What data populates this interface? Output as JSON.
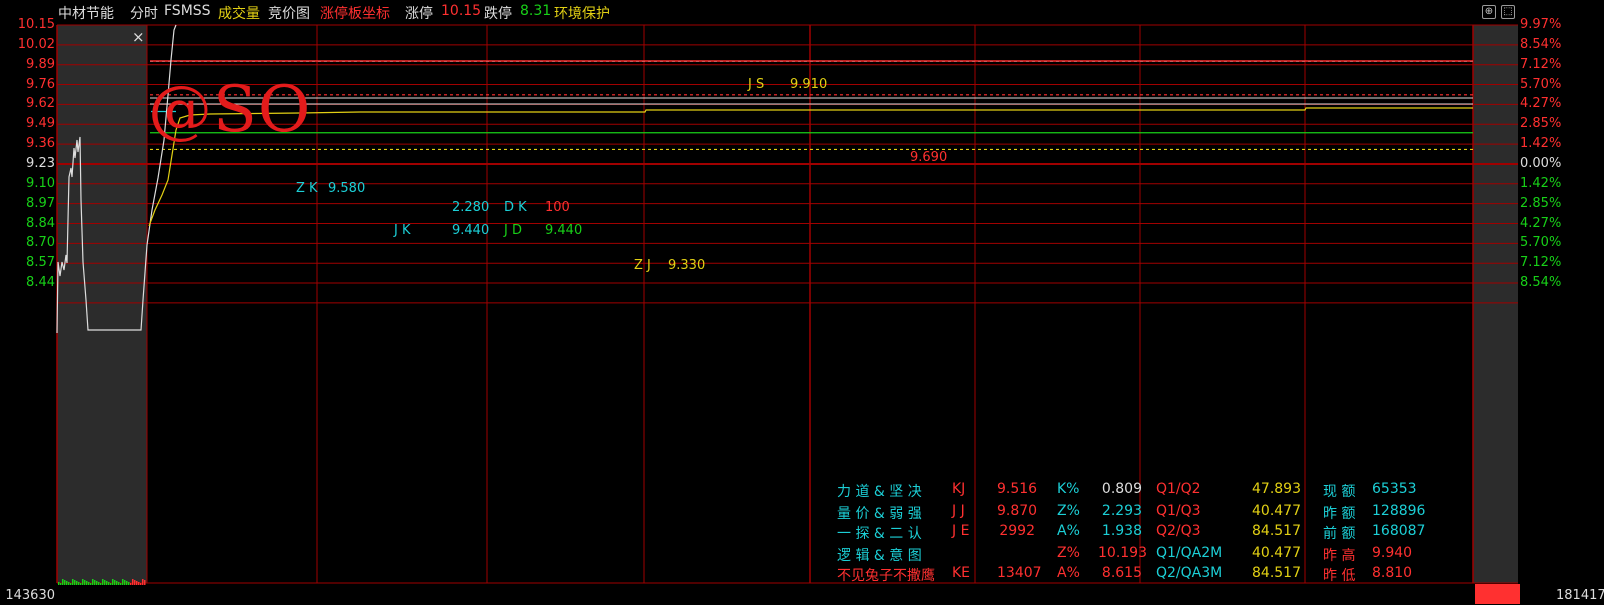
{
  "header": {
    "stock_name": "中材节能",
    "mode": "分时",
    "indicator": "FSMSS",
    "volume": "成交量",
    "auction": "竞价图",
    "limit_axis": "涨停板坐标",
    "limit_up_label": "涨停",
    "limit_up_value": "10.15",
    "limit_down_label": "跌停",
    "limit_down_value": "8.31",
    "env": "环境保护"
  },
  "colors": {
    "up": "#ff3030",
    "down": "#18d018",
    "grid": "#a00000",
    "cyan": "#1ccfd6",
    "yellow": "#e2d014",
    "white": "#dddddd"
  },
  "close_label": "×",
  "window_icons": [
    "restore-icon",
    "expand-icon"
  ],
  "watermark": "@SO",
  "y_axis": {
    "prices": [
      "10.15",
      "10.02",
      "9.89",
      "9.76",
      "9.62",
      "9.49",
      "9.36",
      "9.23",
      "9.10",
      "8.97",
      "8.84",
      "8.70",
      "8.57",
      "8.44"
    ],
    "percents": [
      "9.97%",
      "8.54%",
      "7.12%",
      "5.70%",
      "4.27%",
      "2.85%",
      "1.42%",
      "0.00%",
      "1.42%",
      "2.85%",
      "4.27%",
      "5.70%",
      "7.12%",
      "8.54%"
    ],
    "volume_left": "143630",
    "volume_right": "181417"
  },
  "price_lines": [
    {
      "label": "JS",
      "value": "9.910",
      "price": 9.91,
      "color": "#1ccfd6",
      "style": "dashed"
    },
    {
      "label": "",
      "value": "9.690",
      "price": 9.69,
      "color": "#ff3030",
      "style": "dashed"
    },
    {
      "label": "ZK",
      "value": "9.580",
      "price": 9.58,
      "color": "#1ccfd6",
      "style": "tick"
    },
    {
      "label": "JK",
      "value": "9.440",
      "price": 9.44,
      "color": "#18d018",
      "style": "solid"
    },
    {
      "label": "ZJ",
      "value": "9.330",
      "price": 9.33,
      "color": "#e2d014",
      "style": "dashed"
    }
  ],
  "annotations": {
    "js_label": "J S",
    "js_value": "9.910",
    "red_value": "9.690",
    "zk_label": "Z K",
    "zk_value": "9.580",
    "dk_pre": "2.280",
    "dk_label": "D K",
    "dk_value": "100",
    "jk_label": "J K",
    "jk_value": "9.440",
    "jd_label": "J D",
    "jd_value": "9.440",
    "zj_label": "Z J",
    "zj_value": "9.330"
  },
  "panel": {
    "rows": [
      {
        "name": "力 道 & 坚 决",
        "code": "KJ",
        "val": "9.516",
        "k": "K%",
        "kv": "0.809",
        "q": "Q1/Q2",
        "qv": "47.893",
        "m": "现 额",
        "mv": "65353"
      },
      {
        "name": "量 价 & 弱 强",
        "code": "J J",
        "val": "9.870",
        "k": "Z%",
        "kv": "2.293",
        "q": "Q1/Q3",
        "qv": "40.477",
        "m": "昨 额",
        "mv": "128896"
      },
      {
        "name": "一 探 & 二 认",
        "code": "J E",
        "val": "2992",
        "k": "A%",
        "kv": "1.938",
        "q": "Q2/Q3",
        "qv": "84.517",
        "m": "前 额",
        "mv": "168087"
      },
      {
        "name": "逻 辑 & 意 图",
        "code": "",
        "val": "",
        "k": "Z%",
        "kv": "10.193",
        "q": "Q1/QA2M",
        "qv": "40.477",
        "m": "昨 高",
        "mv": "9.940"
      },
      {
        "name": "不见兔子不撒鹰",
        "code": "KE",
        "val": "13407",
        "k": "A%",
        "kv": "8.615",
        "q": "Q2/QA3M",
        "qv": "84.517",
        "m": "昨 低",
        "mv": "8.810"
      }
    ]
  }
}
